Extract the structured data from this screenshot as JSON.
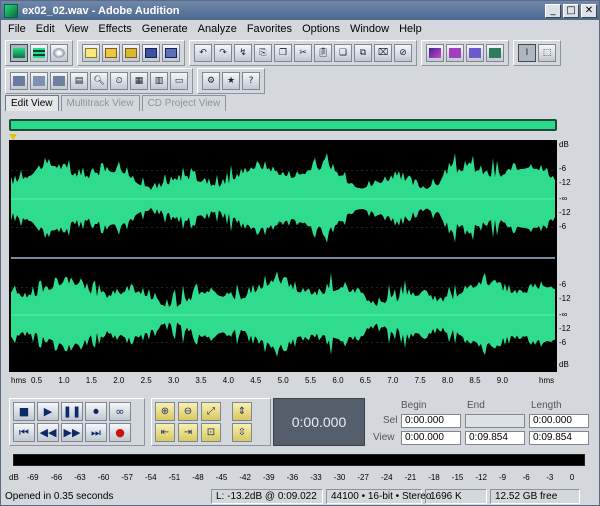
{
  "window": {
    "title": "ex02_02.wav - Adobe Audition",
    "buttons": {
      "minimize": "_",
      "maximize": "□",
      "close": "✕"
    }
  },
  "menu": [
    "File",
    "Edit",
    "View",
    "Effects",
    "Generate",
    "Analyze",
    "Favorites",
    "Options",
    "Window",
    "Help"
  ],
  "tabs": [
    {
      "label": "Edit View",
      "active": true
    },
    {
      "label": "Multitrack View",
      "active": false
    },
    {
      "label": "CD Project View",
      "active": false
    }
  ],
  "db_scale": {
    "unit": "dB",
    "labels_top": [
      "-6",
      "-12",
      "-∞",
      "-12",
      "-6"
    ],
    "unit_bottom": "dB"
  },
  "time_ruler": {
    "unit": "hms",
    "ticks": [
      "0.5",
      "1.0",
      "1.5",
      "2.0",
      "2.5",
      "3.0",
      "3.5",
      "4.0",
      "4.5",
      "5.0",
      "5.5",
      "6.0",
      "6.5",
      "7.0",
      "7.5",
      "8.0",
      "8.5",
      "9.0"
    ],
    "end_unit": "hms"
  },
  "transport": {
    "row1": [
      "■",
      "▶",
      "❚❚",
      "⏺",
      "∞"
    ],
    "row2": [
      "⏮",
      "◀◀",
      "▶▶",
      "⏭",
      "●"
    ]
  },
  "time_display": "0:00.000",
  "selection": {
    "headers": [
      "Begin",
      "End",
      "Length"
    ],
    "sel_label": "Sel",
    "view_label": "View",
    "sel": {
      "begin": "0:00.000",
      "end": "",
      "length": "0:00.000"
    },
    "view": {
      "begin": "0:00.000",
      "end": "0:09.854",
      "length": "0:09.854"
    }
  },
  "level_meter": {
    "unit": "dB",
    "ticks": [
      "-69",
      "-66",
      "-63",
      "-60",
      "-57",
      "-54",
      "-51",
      "-48",
      "-45",
      "-42",
      "-39",
      "-36",
      "-33",
      "-30",
      "-27",
      "-24",
      "-21",
      "-18",
      "-15",
      "-12",
      "-9",
      "-6",
      "-3",
      "0"
    ]
  },
  "status": {
    "message": "Opened in 0.35 seconds",
    "cursor": "L: -13.2dB @  0:09.022",
    "format": "44100 • 16-bit • Stereo",
    "size": "1696 K",
    "free": "12.52 GB free"
  },
  "colors": {
    "waveform": "#2fdc8e",
    "background": "#000000",
    "overview": "#2bd98a"
  }
}
